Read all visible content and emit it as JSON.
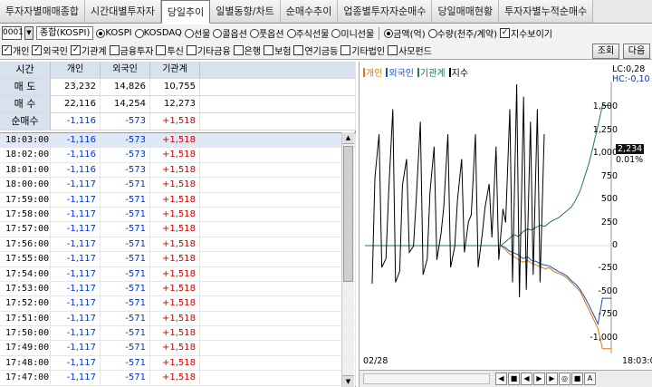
{
  "tabs": [
    "투자자별매매종합",
    "시간대별투자자",
    "당일추이",
    "일별동향/차트",
    "순매수추이",
    "업종별투자자순매수",
    "당일매매현황",
    "투자자별누적순매수"
  ],
  "active_tab": 2,
  "toolbar": {
    "code": "0001",
    "market_name": "종합(KOSPI)",
    "radios": [
      "KOSPI",
      "KOSDAQ",
      "선물",
      "콜옵션",
      "풋옵션",
      "주식선물",
      "미니선물"
    ],
    "radio_selected": "KOSPI",
    "unit_radios": [
      "금액(억)",
      "수량(천주/계약)"
    ],
    "unit_selected": "금액(억)",
    "index_view_label": "지수보이기"
  },
  "filters": [
    {
      "label": "개인",
      "checked": true
    },
    {
      "label": "외국인",
      "checked": true
    },
    {
      "label": "기관계",
      "checked": true
    },
    {
      "label": "금융투자",
      "checked": false
    },
    {
      "label": "투신",
      "checked": false
    },
    {
      "label": "기타금융",
      "checked": false
    },
    {
      "label": "은행",
      "checked": false
    },
    {
      "label": "보험",
      "checked": false
    },
    {
      "label": "연기금등",
      "checked": false
    },
    {
      "label": "기타법인",
      "checked": false
    },
    {
      "label": "사모펀드",
      "checked": false
    }
  ],
  "buttons": {
    "search": "조회",
    "next": "다음"
  },
  "summary": {
    "headers": [
      "시간",
      "개인",
      "외국인",
      "기관계"
    ],
    "rows": [
      {
        "label": "매 도",
        "values": [
          "23,232",
          "14,826",
          "10,755"
        ]
      },
      {
        "label": "매 수",
        "values": [
          "22,116",
          "14,254",
          "12,273"
        ]
      },
      {
        "label": "순매수",
        "values": [
          "-1,116",
          "-573",
          "+1,518"
        ]
      }
    ]
  },
  "rows": [
    {
      "time": "18:03:00",
      "ind": "-1,116",
      "frn": "-573",
      "inst": "+1,518"
    },
    {
      "time": "18:02:00",
      "ind": "-1,116",
      "frn": "-573",
      "inst": "+1,518"
    },
    {
      "time": "18:01:00",
      "ind": "-1,116",
      "frn": "-573",
      "inst": "+1,518"
    },
    {
      "time": "18:00:00",
      "ind": "-1,117",
      "frn": "-571",
      "inst": "+1,518"
    },
    {
      "time": "17:59:00",
      "ind": "-1,117",
      "frn": "-571",
      "inst": "+1,518"
    },
    {
      "time": "17:58:00",
      "ind": "-1,117",
      "frn": "-571",
      "inst": "+1,518"
    },
    {
      "time": "17:57:00",
      "ind": "-1,117",
      "frn": "-571",
      "inst": "+1,518"
    },
    {
      "time": "17:56:00",
      "ind": "-1,117",
      "frn": "-571",
      "inst": "+1,518"
    },
    {
      "time": "17:55:00",
      "ind": "-1,117",
      "frn": "-571",
      "inst": "+1,518"
    },
    {
      "time": "17:54:00",
      "ind": "-1,117",
      "frn": "-571",
      "inst": "+1,518"
    },
    {
      "time": "17:53:00",
      "ind": "-1,117",
      "frn": "-571",
      "inst": "+1,518"
    },
    {
      "time": "17:52:00",
      "ind": "-1,117",
      "frn": "-571",
      "inst": "+1,518"
    },
    {
      "time": "17:51:00",
      "ind": "-1,117",
      "frn": "-571",
      "inst": "+1,518"
    },
    {
      "time": "17:50:00",
      "ind": "-1,117",
      "frn": "-571",
      "inst": "+1,518"
    },
    {
      "time": "17:49:00",
      "ind": "-1,117",
      "frn": "-571",
      "inst": "+1,518"
    },
    {
      "time": "17:48:00",
      "ind": "-1,117",
      "frn": "-571",
      "inst": "+1,518"
    },
    {
      "time": "17:47:00",
      "ind": "-1,117",
      "frn": "-571",
      "inst": "+1,518"
    }
  ],
  "chart": {
    "legend": [
      {
        "name": "개인",
        "color": "#e07a00"
      },
      {
        "name": "외국인",
        "color": "#1a4fbf"
      },
      {
        "name": "기관계",
        "color": "#1e7a5a"
      },
      {
        "name": "지수",
        "color": "#000000"
      }
    ],
    "lc_label": "LC:0,28",
    "hc_label": "HC:-0,10",
    "yticks": [
      "1,500",
      "1,250",
      "1,000",
      "750",
      "500",
      "250",
      "0",
      "-250",
      "-500",
      "-750",
      "-1,000"
    ],
    "index_tag": "2,234",
    "pct_tag": "0.01%",
    "date_label": "02/28",
    "time_label": "18:03:0",
    "control_icons": [
      "◀",
      "■",
      "◀",
      "▶",
      "▶",
      "◎",
      "■",
      "A"
    ]
  },
  "chart_data": {
    "type": "line",
    "ylim": [
      -1100,
      1700
    ],
    "series": [
      {
        "name": "개인",
        "values": [
          0,
          -40,
          -90,
          -120,
          -150,
          -180,
          -160,
          -190,
          -210,
          -230,
          -250,
          -240,
          -280,
          -300,
          -320,
          -350,
          -400,
          -450,
          -500,
          -600,
          -700,
          -800,
          -900,
          -1117,
          -1117,
          -1117
        ]
      },
      {
        "name": "외국인",
        "values": [
          0,
          -20,
          -60,
          -80,
          -100,
          -140,
          -120,
          -160,
          -170,
          -200,
          -210,
          -220,
          -250,
          -280,
          -300,
          -330,
          -380,
          -420,
          -480,
          -560,
          -650,
          -750,
          -850,
          -571,
          -571,
          -571
        ]
      },
      {
        "name": "기관계",
        "values": [
          0,
          40,
          80,
          120,
          100,
          150,
          180,
          170,
          200,
          220,
          210,
          250,
          280,
          300,
          340,
          380,
          420,
          500,
          600,
          750,
          900,
          1100,
          1300,
          1518,
          1518,
          1518
        ]
      }
    ],
    "index_line": [
      0.2,
      0.8,
      0.3,
      0.9,
      0.25,
      0.7,
      0.35,
      0.85,
      0.3,
      0.75,
      0.4,
      0.8,
      0.35,
      0.7,
      0.45,
      0.8,
      0.4,
      0.6,
      0.75,
      0.5,
      0.9,
      1.0,
      0.95,
      0.85,
      0.9,
      0.8
    ]
  }
}
